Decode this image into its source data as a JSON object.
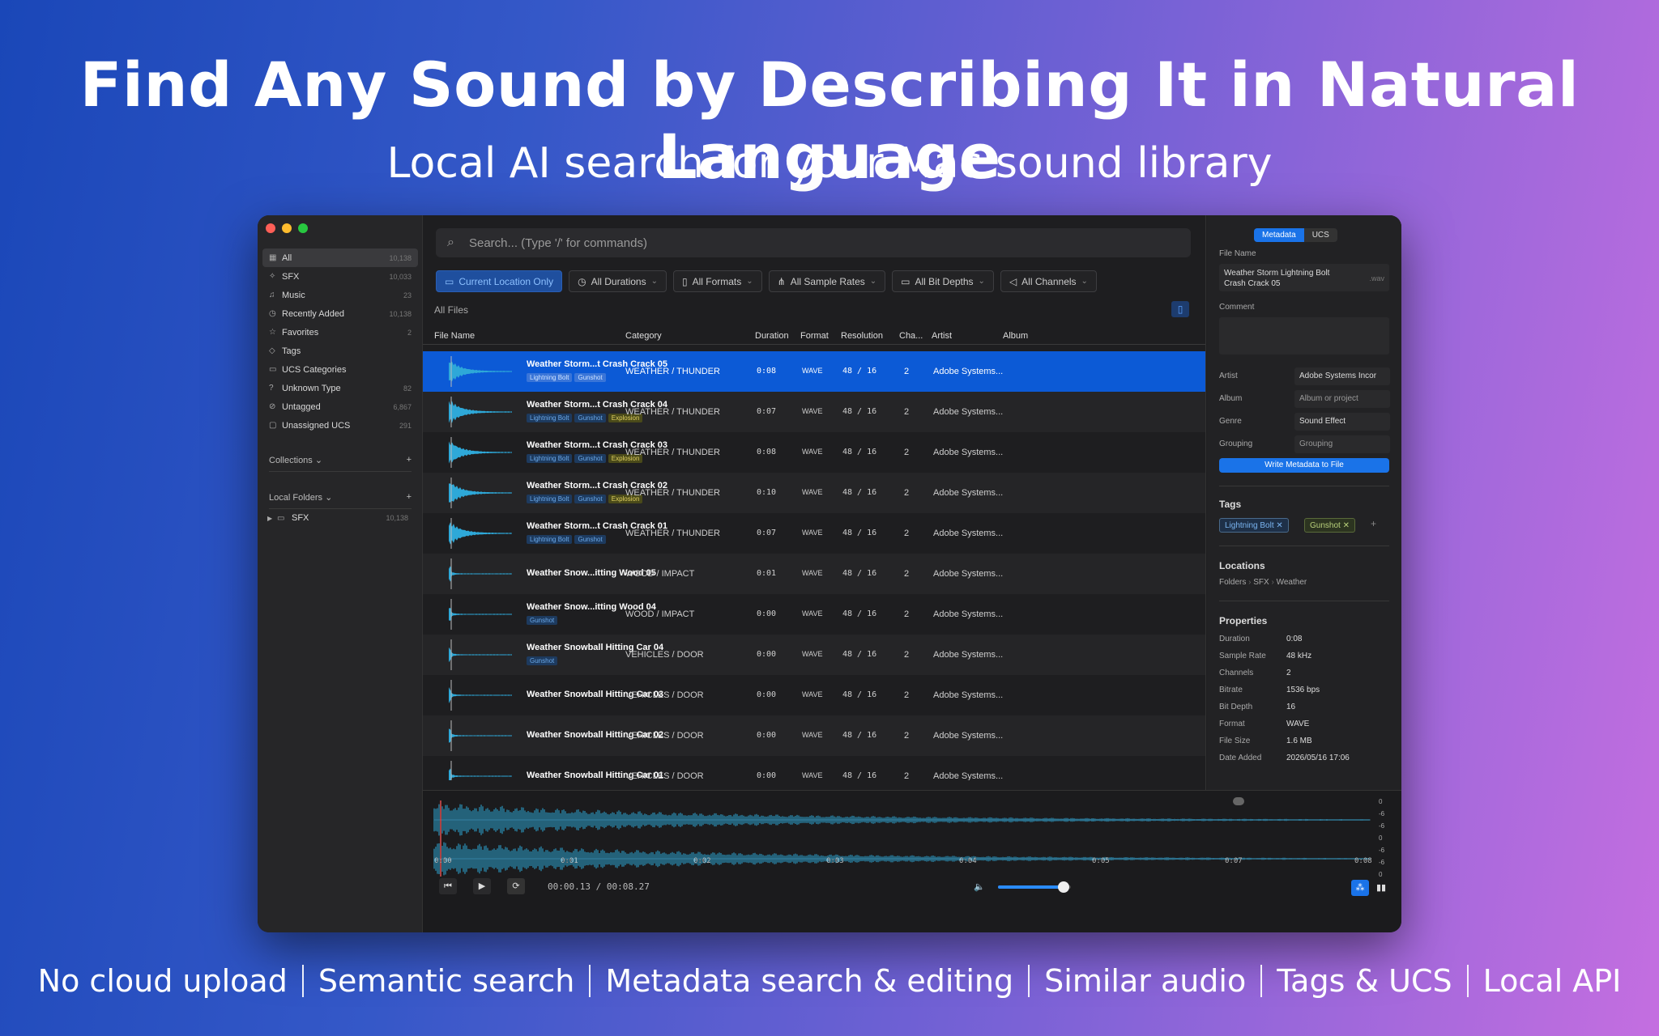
{
  "headline": "Find Any Sound by Describing It in Natural Language",
  "subline": "Local AI search for your Mac sound library",
  "features": [
    "No cloud upload",
    "Semantic search",
    "Metadata search & editing",
    "Similar audio",
    "Tags & UCS",
    "Local API"
  ],
  "colors": {
    "accent": "#1a73e8",
    "selection": "#0c5ad6",
    "waveform": "#2ea8d8"
  },
  "sidebar": {
    "items": [
      {
        "icon": "grid-icon",
        "label": "All",
        "count": "10,138"
      },
      {
        "icon": "sparkle-icon",
        "label": "SFX",
        "count": "10,033"
      },
      {
        "icon": "music-icon",
        "label": "Music",
        "count": "23"
      },
      {
        "icon": "clock-icon",
        "label": "Recently Added",
        "count": "10,138"
      },
      {
        "icon": "star-icon",
        "label": "Favorites",
        "count": "2"
      },
      {
        "icon": "tag-icon",
        "label": "Tags",
        "count": ""
      },
      {
        "icon": "folder-icon",
        "label": "UCS Categories",
        "count": ""
      },
      {
        "icon": "question-icon",
        "label": "Unknown Type",
        "count": "82"
      },
      {
        "icon": "untag-icon",
        "label": "Untagged",
        "count": "6,867"
      },
      {
        "icon": "box-icon",
        "label": "Unassigned UCS",
        "count": "291"
      }
    ],
    "collections_label": "Collections",
    "local_folders_label": "Local Folders",
    "folder": {
      "label": "SFX",
      "count": "10,138"
    }
  },
  "search": {
    "placeholder": "Search... (Type '/' for commands)"
  },
  "filters": [
    "Current Location Only",
    "All Durations",
    "All Formats",
    "All Sample Rates",
    "All Bit Depths",
    "All Channels"
  ],
  "all_files_label": "All Files",
  "columns": [
    "File Name",
    "Category",
    "Duration",
    "Format",
    "Resolution",
    "Cha...",
    "Artist",
    "Album"
  ],
  "rows": [
    {
      "name": "Weather Storm...t Crash Crack 05",
      "tags": [
        "Lightning Bolt",
        "Gunshot"
      ],
      "category": "WEATHER / THUNDER",
      "duration": "0:08",
      "format": "WAVE",
      "resolution": "48 / 16",
      "channels": "2",
      "artist": "Adobe Systems..."
    },
    {
      "name": "Weather Storm...t Crash Crack 04",
      "tags": [
        "Lightning Bolt",
        "Gunshot",
        "Explosion"
      ],
      "category": "WEATHER / THUNDER",
      "duration": "0:07",
      "format": "WAVE",
      "resolution": "48 / 16",
      "channels": "2",
      "artist": "Adobe Systems..."
    },
    {
      "name": "Weather Storm...t Crash Crack 03",
      "tags": [
        "Lightning Bolt",
        "Gunshot",
        "Explosion"
      ],
      "category": "WEATHER / THUNDER",
      "duration": "0:08",
      "format": "WAVE",
      "resolution": "48 / 16",
      "channels": "2",
      "artist": "Adobe Systems..."
    },
    {
      "name": "Weather Storm...t Crash Crack 02",
      "tags": [
        "Lightning Bolt",
        "Gunshot",
        "Explosion"
      ],
      "category": "WEATHER / THUNDER",
      "duration": "0:10",
      "format": "WAVE",
      "resolution": "48 / 16",
      "channels": "2",
      "artist": "Adobe Systems..."
    },
    {
      "name": "Weather Storm...t Crash Crack 01",
      "tags": [
        "Lightning Bolt",
        "Gunshot"
      ],
      "category": "WEATHER / THUNDER",
      "duration": "0:07",
      "format": "WAVE",
      "resolution": "48 / 16",
      "channels": "2",
      "artist": "Adobe Systems..."
    },
    {
      "name": "Weather Snow...itting Wood 05",
      "tags": [],
      "category": "WOOD / IMPACT",
      "duration": "0:01",
      "format": "WAVE",
      "resolution": "48 / 16",
      "channels": "2",
      "artist": "Adobe Systems..."
    },
    {
      "name": "Weather Snow...itting Wood 04",
      "tags": [
        "Gunshot"
      ],
      "category": "WOOD / IMPACT",
      "duration": "0:00",
      "format": "WAVE",
      "resolution": "48 / 16",
      "channels": "2",
      "artist": "Adobe Systems..."
    },
    {
      "name": "Weather Snowball Hitting Car 04",
      "tags": [
        "Gunshot"
      ],
      "category": "VEHICLES / DOOR",
      "duration": "0:00",
      "format": "WAVE",
      "resolution": "48 / 16",
      "channels": "2",
      "artist": "Adobe Systems..."
    },
    {
      "name": "Weather Snowball Hitting Car 03",
      "tags": [],
      "category": "VEHICLES / DOOR",
      "duration": "0:00",
      "format": "WAVE",
      "resolution": "48 / 16",
      "channels": "2",
      "artist": "Adobe Systems..."
    },
    {
      "name": "Weather Snowball Hitting Car 02",
      "tags": [],
      "category": "VEHICLES / DOOR",
      "duration": "0:00",
      "format": "WAVE",
      "resolution": "48 / 16",
      "channels": "2",
      "artist": "Adobe Systems..."
    },
    {
      "name": "Weather Snowball Hitting Car 01",
      "tags": [],
      "category": "VEHICLES / DOOR",
      "duration": "0:00",
      "format": "WAVE",
      "resolution": "48 / 16",
      "channels": "2",
      "artist": "Adobe Systems..."
    }
  ],
  "panel": {
    "tabs": [
      "Metadata",
      "UCS"
    ],
    "file_name_label": "File Name",
    "file_name_line1": "Weather Storm Lightning Bolt",
    "file_name_line2": "Crash Crack 05",
    "file_ext": ".wav",
    "comment_label": "Comment",
    "fields": [
      {
        "label": "Artist",
        "value": "Adobe Systems Incor",
        "placeholder": false
      },
      {
        "label": "Album",
        "value": "Album or project",
        "placeholder": true
      },
      {
        "label": "Genre",
        "value": "Sound Effect",
        "placeholder": false
      },
      {
        "label": "Grouping",
        "value": "Grouping",
        "placeholder": true
      }
    ],
    "write_button": "Write Metadata to File",
    "tags_label": "Tags",
    "tags": [
      "Lightning Bolt",
      "Gunshot"
    ],
    "add_tag": "+",
    "locations_label": "Locations",
    "location_path": [
      "Folders",
      "SFX",
      "Weather"
    ],
    "properties_label": "Properties",
    "properties": [
      {
        "label": "Duration",
        "value": "0:08"
      },
      {
        "label": "Sample Rate",
        "value": "48 kHz"
      },
      {
        "label": "Channels",
        "value": "2"
      },
      {
        "label": "Bitrate",
        "value": "1536 bps"
      },
      {
        "label": "Bit Depth",
        "value": "16"
      },
      {
        "label": "Format",
        "value": "WAVE"
      },
      {
        "label": "File Size",
        "value": "1.6 MB"
      },
      {
        "label": "Date Added",
        "value": "2026/05/16 17:06"
      }
    ]
  },
  "player": {
    "time": "00:00.13 / 00:08.27",
    "ticks": [
      "0:00",
      "0:01",
      "0:02",
      "0:03",
      "0:04",
      "0:05",
      "0:07",
      "0:08"
    ],
    "db_labels": [
      "0",
      "-6",
      "-6",
      "0",
      "-6",
      "-6",
      "0"
    ],
    "volume": 0.9
  }
}
